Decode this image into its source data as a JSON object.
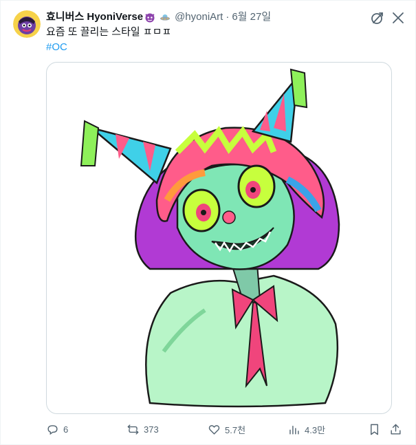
{
  "tweet": {
    "author_name": "효니버스 HyoniVerse",
    "handle": "@hyoniArt",
    "separator": "·",
    "date": "6월 27일",
    "text": "요즘 또 끌리는 스타일 ㅍㅁㅍ",
    "hashtag": "#OC"
  },
  "actions": {
    "replies": "6",
    "reposts": "373",
    "likes": "5.7천",
    "views": "4.3만"
  },
  "colors": {
    "text": "#0f1419",
    "secondary": "#536471",
    "link": "#1d9bf0",
    "border": "#cfd9de"
  },
  "icons": [
    "avatar",
    "purple-face-emoji",
    "ufo-emoji",
    "grok-icon",
    "more-icon",
    "reply-icon",
    "repost-icon",
    "like-icon",
    "views-icon",
    "bookmark-icon",
    "share-icon"
  ]
}
